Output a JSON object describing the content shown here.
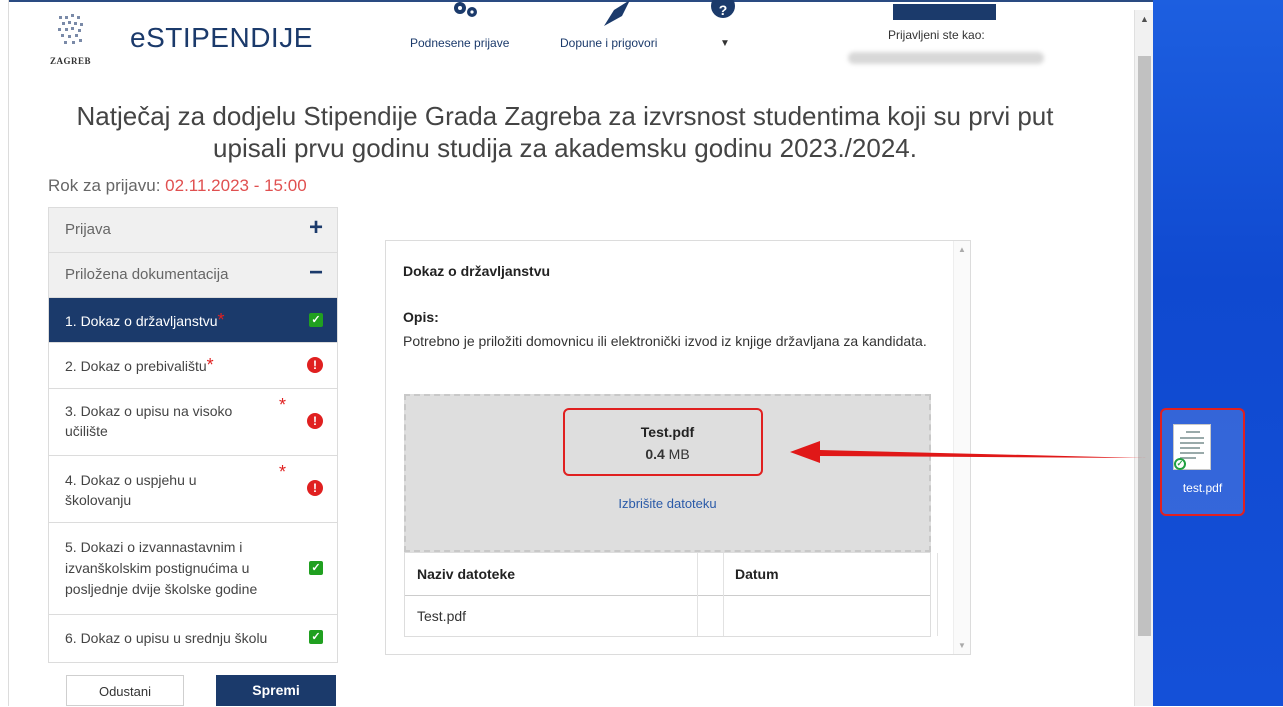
{
  "header": {
    "brand": "eSTIPENDIJE",
    "logo_city": "ZAGREB",
    "nav": [
      {
        "label": "Podnesene prijave",
        "icon": "gears-icon"
      },
      {
        "label": "Dopune i prigovori",
        "icon": "rocket-icon"
      },
      {
        "label": "",
        "icon": "help-icon"
      }
    ],
    "user_label": "Prijavljeni ste kao:"
  },
  "page": {
    "title_line1": "Natječaj za dodjelu Stipendije Grada Zagreba za izvrsnost studentima koji su prvi put",
    "title_line2": "upisali prvu godinu studija za akademsku godinu 2023./2024.",
    "deadline_label": "Rok za prijavu:",
    "deadline_value": "02.11.2023 - 15:00"
  },
  "sidebar": {
    "sections": [
      {
        "label": "Prijava",
        "toggle": "+"
      },
      {
        "label": "Priložena dokumentacija",
        "toggle": "−"
      }
    ],
    "docs": [
      {
        "label": "1. Dokaz o državljanstvu",
        "required": true,
        "status": "ok"
      },
      {
        "label": "2. Dokaz o prebivalištu",
        "required": true,
        "status": "missing"
      },
      {
        "label": "3. Dokaz o upisu na visoko učilište",
        "required": true,
        "status": "missing"
      },
      {
        "label": "4. Dokaz o uspjehu u školovanju",
        "required": true,
        "status": "missing"
      },
      {
        "label": "5. Dokazi o izvannastavnim i izvanškolskim postignućima u posljednje dvije školske godine",
        "required": false,
        "status": "ok"
      },
      {
        "label": "6. Dokaz o upisu u srednju školu",
        "required": false,
        "status": "ok"
      }
    ],
    "cancel_label": "Odustani",
    "save_label": "Spremi"
  },
  "detail": {
    "title": "Dokaz o državljanstvu",
    "opis_label": "Opis:",
    "description": "Potrebno je priložiti domovnicu ili elektronički izvod iz knjige državljana za kandidata.",
    "file": {
      "name": "Test.pdf",
      "size_value": "0.4",
      "size_unit": "MB"
    },
    "delete_label": "Izbrišite datoteku",
    "table": {
      "headers": [
        "Naziv datoteke",
        "Datum"
      ],
      "rows": [
        [
          "Test.pdf",
          ""
        ]
      ]
    }
  },
  "desktop": {
    "file_label": "test.pdf",
    "highlight_color": "#e02020"
  },
  "colors": {
    "brand": "#1b3a6b",
    "ok": "#20a020",
    "error": "#e02020",
    "deadline": "#e05050"
  }
}
